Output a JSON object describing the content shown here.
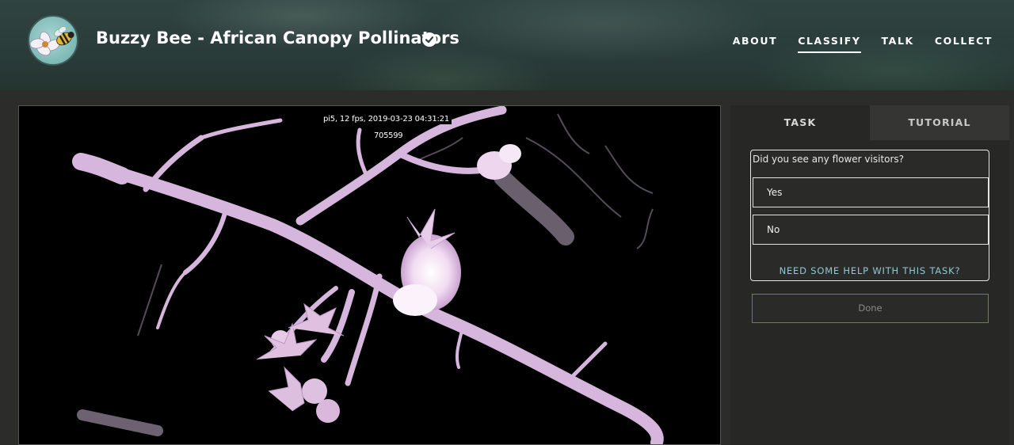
{
  "header": {
    "title": "Buzzy Bee - African Canopy Pollinators",
    "verified_icon": "check-circle-icon",
    "avatar_icon": "bee-and-flower-icon",
    "nav": [
      {
        "label": "ABOUT",
        "active": false
      },
      {
        "label": "CLASSIFY",
        "active": true
      },
      {
        "label": "TALK",
        "active": false
      },
      {
        "label": "COLLECT",
        "active": false
      }
    ]
  },
  "viewer": {
    "camera_stamp": "pi5, 12 fps, 2019-03-23 04:31:21",
    "frame_number": "705599"
  },
  "task_panel": {
    "tabs": [
      {
        "label": "TASK",
        "active": true
      },
      {
        "label": "TUTORIAL",
        "active": false
      }
    ],
    "question": "Did you see any flower visitors?",
    "answers": [
      "Yes",
      "No"
    ],
    "help_link": "NEED SOME HELP WITH THIS TASK?",
    "done_label": "Done"
  },
  "colors": {
    "header_bg": "#2a3c3a",
    "page_bg": "#2c2d2b",
    "panel_bg": "#272826",
    "help_link": "#8fc9d6",
    "done_border": "#6e7f55",
    "infrared_branch": "#dcb8e0"
  }
}
